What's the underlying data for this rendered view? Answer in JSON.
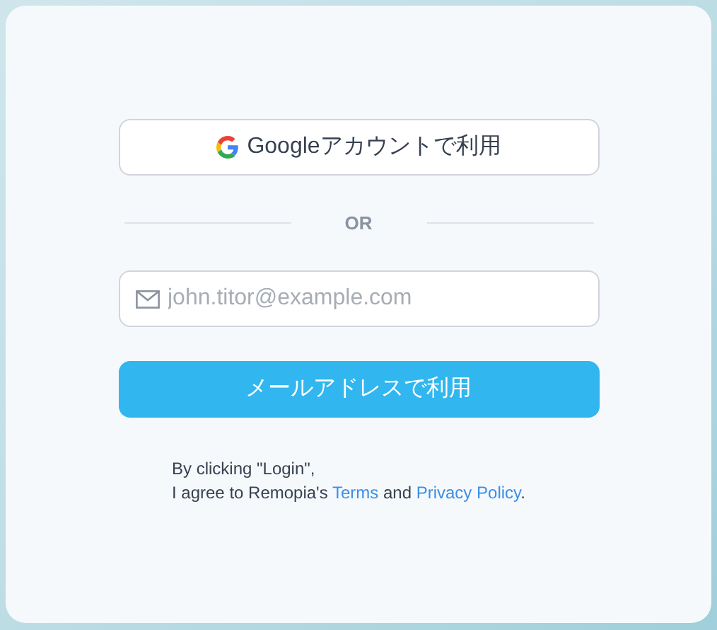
{
  "google_button": {
    "label": "Googleアカウントで利用"
  },
  "divider": {
    "label": "OR"
  },
  "email_field": {
    "placeholder": "john.titor@example.com"
  },
  "email_button": {
    "label": "メールアドレスで利用"
  },
  "consent": {
    "line_1": "By clicking \"Login\",",
    "prefix": "I agree to Remopia's",
    "terms_link": "Terms",
    "conjunction": "and",
    "privacy_link": "Privacy Policy",
    "suffix": "."
  }
}
